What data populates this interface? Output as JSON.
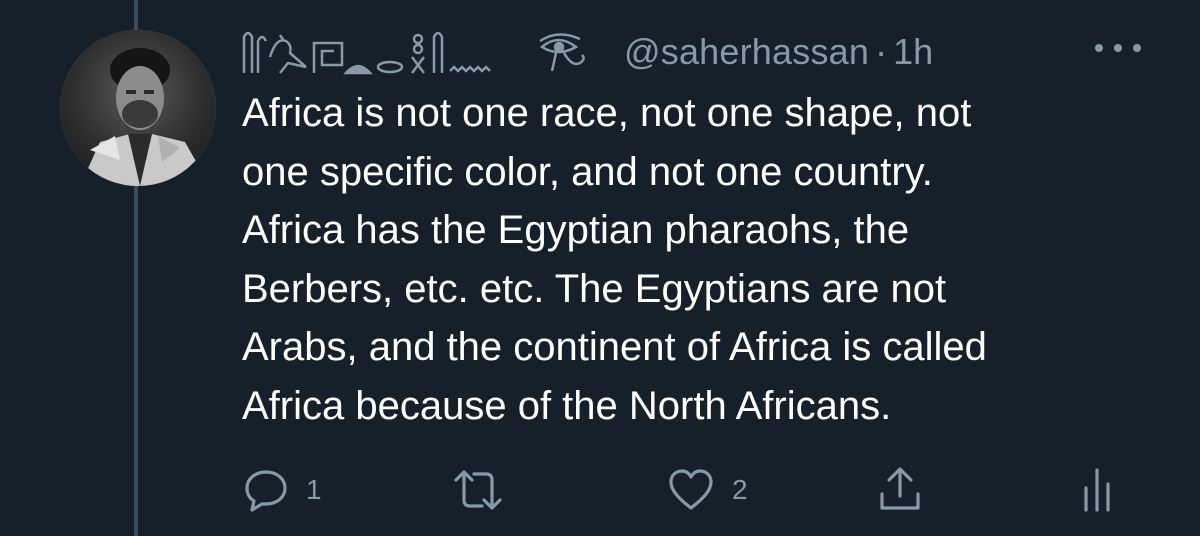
{
  "tweet": {
    "display_name_glyphs": "hieroglyph-name",
    "handle": "@saherhassan",
    "separator": "·",
    "timestamp": "1h",
    "text": "Africa is not one race, not one shape, not\none specific color, and not one country.\nAfrica has the Egyptian pharaohs, the\nBerbers, etc. etc. The Egyptians are not\nArabs, and the continent of Africa is called\nAfrica because of the North Africans."
  },
  "actions": {
    "reply": {
      "icon": "reply-icon",
      "count": "1"
    },
    "retweet": {
      "icon": "retweet-icon",
      "count": ""
    },
    "like": {
      "icon": "heart-icon",
      "count": "2"
    },
    "share": {
      "icon": "share-icon"
    },
    "analytics": {
      "icon": "analytics-icon"
    }
  },
  "colors": {
    "background": "#15202b",
    "secondary_text": "#8899a6",
    "primary_text": "#ffffff",
    "thread_line": "#3d4a57"
  }
}
